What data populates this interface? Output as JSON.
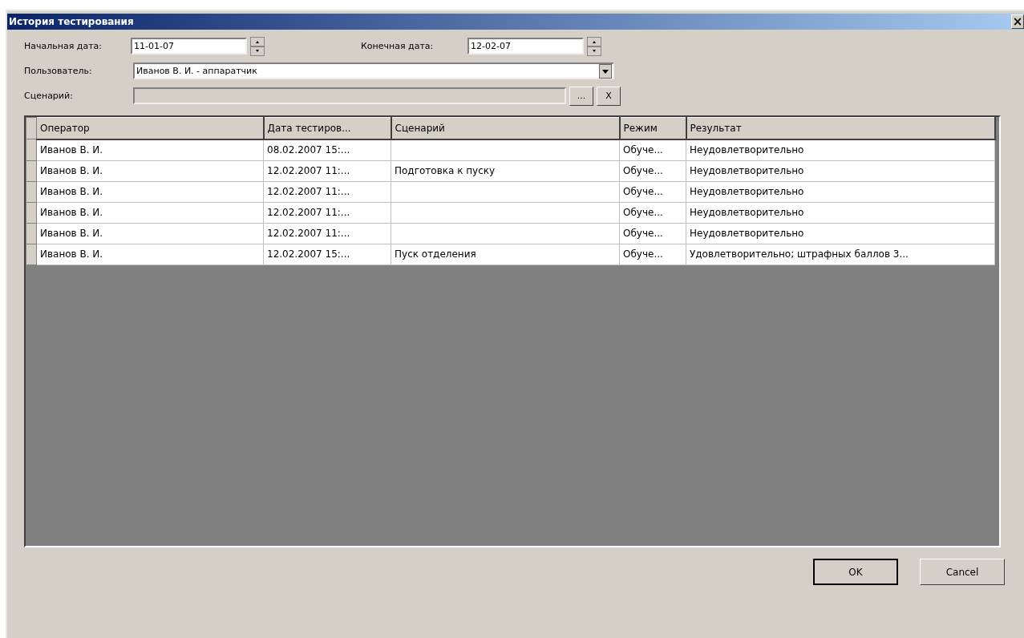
{
  "window": {
    "title": "История тестирования",
    "close": "×"
  },
  "start_date": {
    "label": "Начальная дата:",
    "value": "11-01-07"
  },
  "end_date": {
    "label": "Конечная дата:",
    "value": "12-02-07"
  },
  "user": {
    "label": "Пользователь:",
    "value": "Иванов В. И. - аппаратчик"
  },
  "scenario": {
    "label": "Сценарий:",
    "disabled": true,
    "browse": "...",
    "clear": "X"
  },
  "table": {
    "columns": [
      "Оператор",
      "Дата тестиров...",
      "Сценарий",
      "Режим",
      "Результат"
    ],
    "rows": [
      [
        "Иванов В. И.",
        "08.02.2007 15:...",
        "",
        "Обуче...",
        "Неудовлетворительно"
      ],
      [
        "Иванов В. И.",
        "12.02.2007 11:...",
        "Подготовка к пуску",
        "Обуче...",
        "Неудовлетворительно"
      ],
      [
        "Иванов В. И.",
        "12.02.2007 11:...",
        "",
        "Обуче...",
        "Неудовлетворительно"
      ],
      [
        "Иванов В. И.",
        "12.02.2007 11:...",
        "",
        "Обуче...",
        "Неудовлетворительно"
      ],
      [
        "Иванов В. И.",
        "12.02.2007 11:...",
        "",
        "Обуче...",
        "Неудовлетворительно"
      ],
      [
        "Иванов В. И.",
        "12.02.2007 15:...",
        "Пуск отделения",
        "Обуче...",
        "Удовлетворительно; штрафных баллов 3..."
      ]
    ]
  },
  "buttons": [
    {
      "label": "OK",
      "default": true
    },
    {
      "label": "Cancel",
      "default": false
    }
  ]
}
